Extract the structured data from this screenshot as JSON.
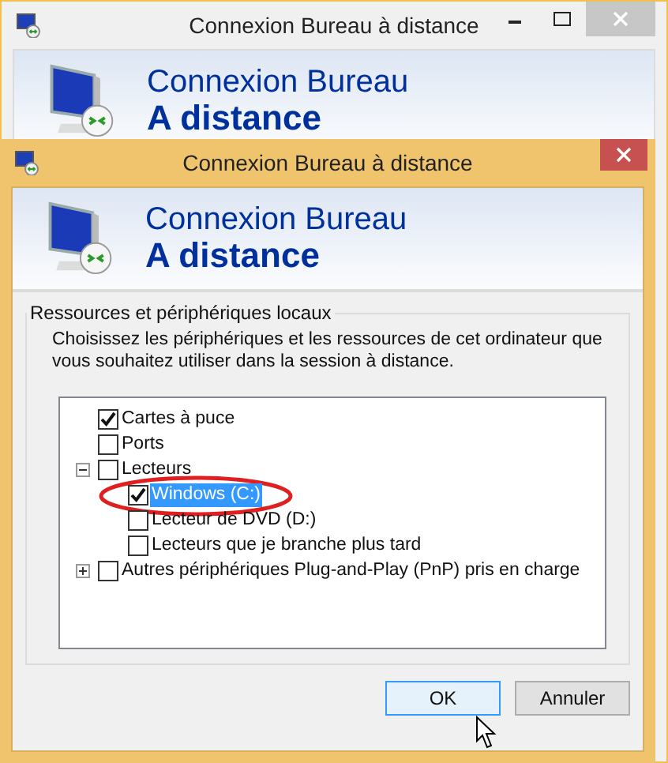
{
  "windows": [
    {
      "title": "Connexion Bureau à distance",
      "active": false,
      "caption_buttons": [
        {
          "kind": "minimize"
        },
        {
          "kind": "maximize"
        },
        {
          "kind": "close"
        }
      ],
      "banner": {
        "line1": "Connexion Bureau",
        "line2": "A distance"
      }
    },
    {
      "title": "Connexion Bureau à distance",
      "active": true,
      "caption_buttons": [
        {
          "kind": "close"
        }
      ],
      "banner": {
        "line1": "Connexion Bureau",
        "line2": "A distance"
      },
      "dialog": {
        "group_label": "Ressources et périphériques locaux",
        "description": "Choisissez les périphériques et les ressources de cet ordinateur que vous souhaitez utiliser dans la session à distance.",
        "tree": [
          {
            "label": "Cartes à puce",
            "checked": true,
            "selected": false
          },
          {
            "label": "Ports",
            "checked": false,
            "selected": false
          },
          {
            "label": "Lecteurs",
            "checked": false,
            "selected": false,
            "expanded": true,
            "children": [
              {
                "label": "Windows (C:)",
                "checked": true,
                "selected": true
              },
              {
                "label": "Lecteur de DVD (D:)",
                "checked": false,
                "selected": false
              },
              {
                "label": "Lecteurs que je branche plus tard",
                "checked": false,
                "selected": false
              }
            ]
          },
          {
            "label": "Autres périphériques Plug-and-Play (PnP) pris en charge",
            "checked": false,
            "selected": false,
            "expanded": false,
            "expandable": true
          }
        ],
        "buttons": [
          {
            "label": "OK",
            "focused": true
          },
          {
            "label": "Annuler",
            "focused": false
          }
        ]
      }
    }
  ]
}
